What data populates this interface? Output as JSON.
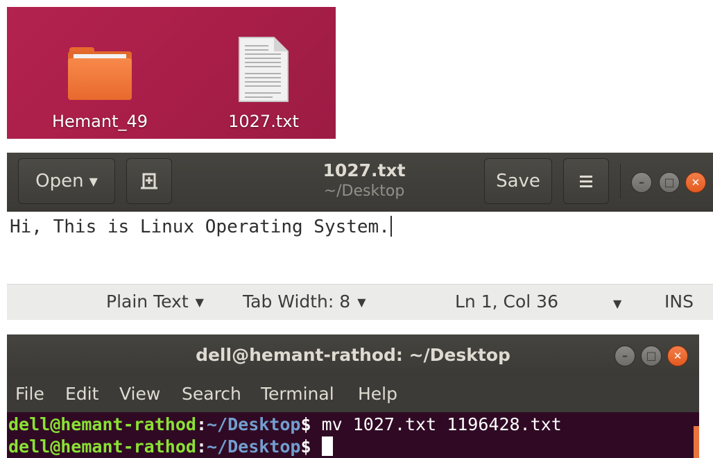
{
  "desktop": {
    "items": [
      {
        "label": "Hemant_49",
        "icon": "folder-icon"
      },
      {
        "label": "1027.txt",
        "icon": "text-file-icon"
      }
    ],
    "background_color": "#a81e48"
  },
  "gedit": {
    "open_label": "Open",
    "title": "1027.txt",
    "subtitle": "~/Desktop",
    "save_label": "Save",
    "content": "Hi, This is Linux Operating System.",
    "status": {
      "language": "Plain Text",
      "tab_width": "Tab Width: 8",
      "position": "Ln 1, Col 36",
      "mode": "INS"
    }
  },
  "terminal": {
    "title": "dell@hemant-rathod: ~/Desktop",
    "menu": [
      "File",
      "Edit",
      "View",
      "Search",
      "Terminal",
      "Help"
    ],
    "lines": [
      {
        "user": "dell@hemant-rathod",
        "sep": ":",
        "path": "~/Desktop",
        "prompt": "$",
        "command": " mv 1027.txt 1196428.txt"
      },
      {
        "user": "dell@hemant-rathod",
        "sep": ":",
        "path": "~/Desktop",
        "prompt": "$",
        "command": " "
      }
    ],
    "colors": {
      "background": "#300a24",
      "user": "#8ae234",
      "path": "#729fcf"
    }
  },
  "colors": {
    "accent": "#e45a1f",
    "headerbar": "#3b3a36"
  }
}
